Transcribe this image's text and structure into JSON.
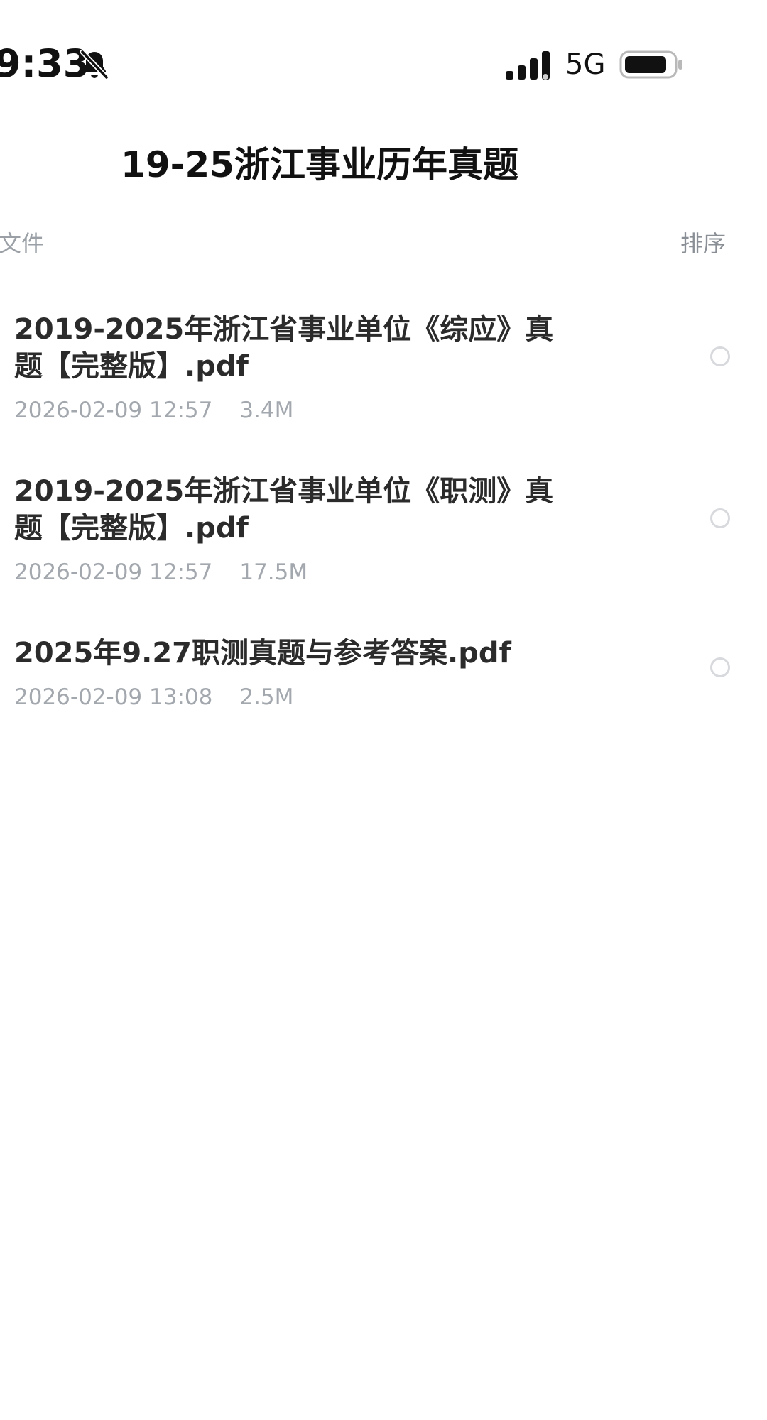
{
  "status_bar": {
    "time": "9:33",
    "mute_icon": "bell-slash-icon",
    "signal_icon": "cellular-signal-icon",
    "network": "5G",
    "battery_icon": "battery-icon"
  },
  "header": {
    "title": "19-25浙江事业历年真题"
  },
  "toolbar": {
    "left_label": "文件",
    "sort_label": "排序"
  },
  "files": [
    {
      "name": "2019-2025年浙江省事业单位《综应》真题【完整版】.pdf",
      "date": "2026-02-09 12:57",
      "size": "3.4M",
      "selected": false
    },
    {
      "name": "2019-2025年浙江省事业单位《职测》真题【完整版】.pdf",
      "date": "2026-02-09 12:57",
      "size": "17.5M",
      "selected": false
    },
    {
      "name": "2025年9.27职测真题与参考答案.pdf",
      "date": "2026-02-09 13:08",
      "size": "2.5M",
      "selected": false
    }
  ]
}
